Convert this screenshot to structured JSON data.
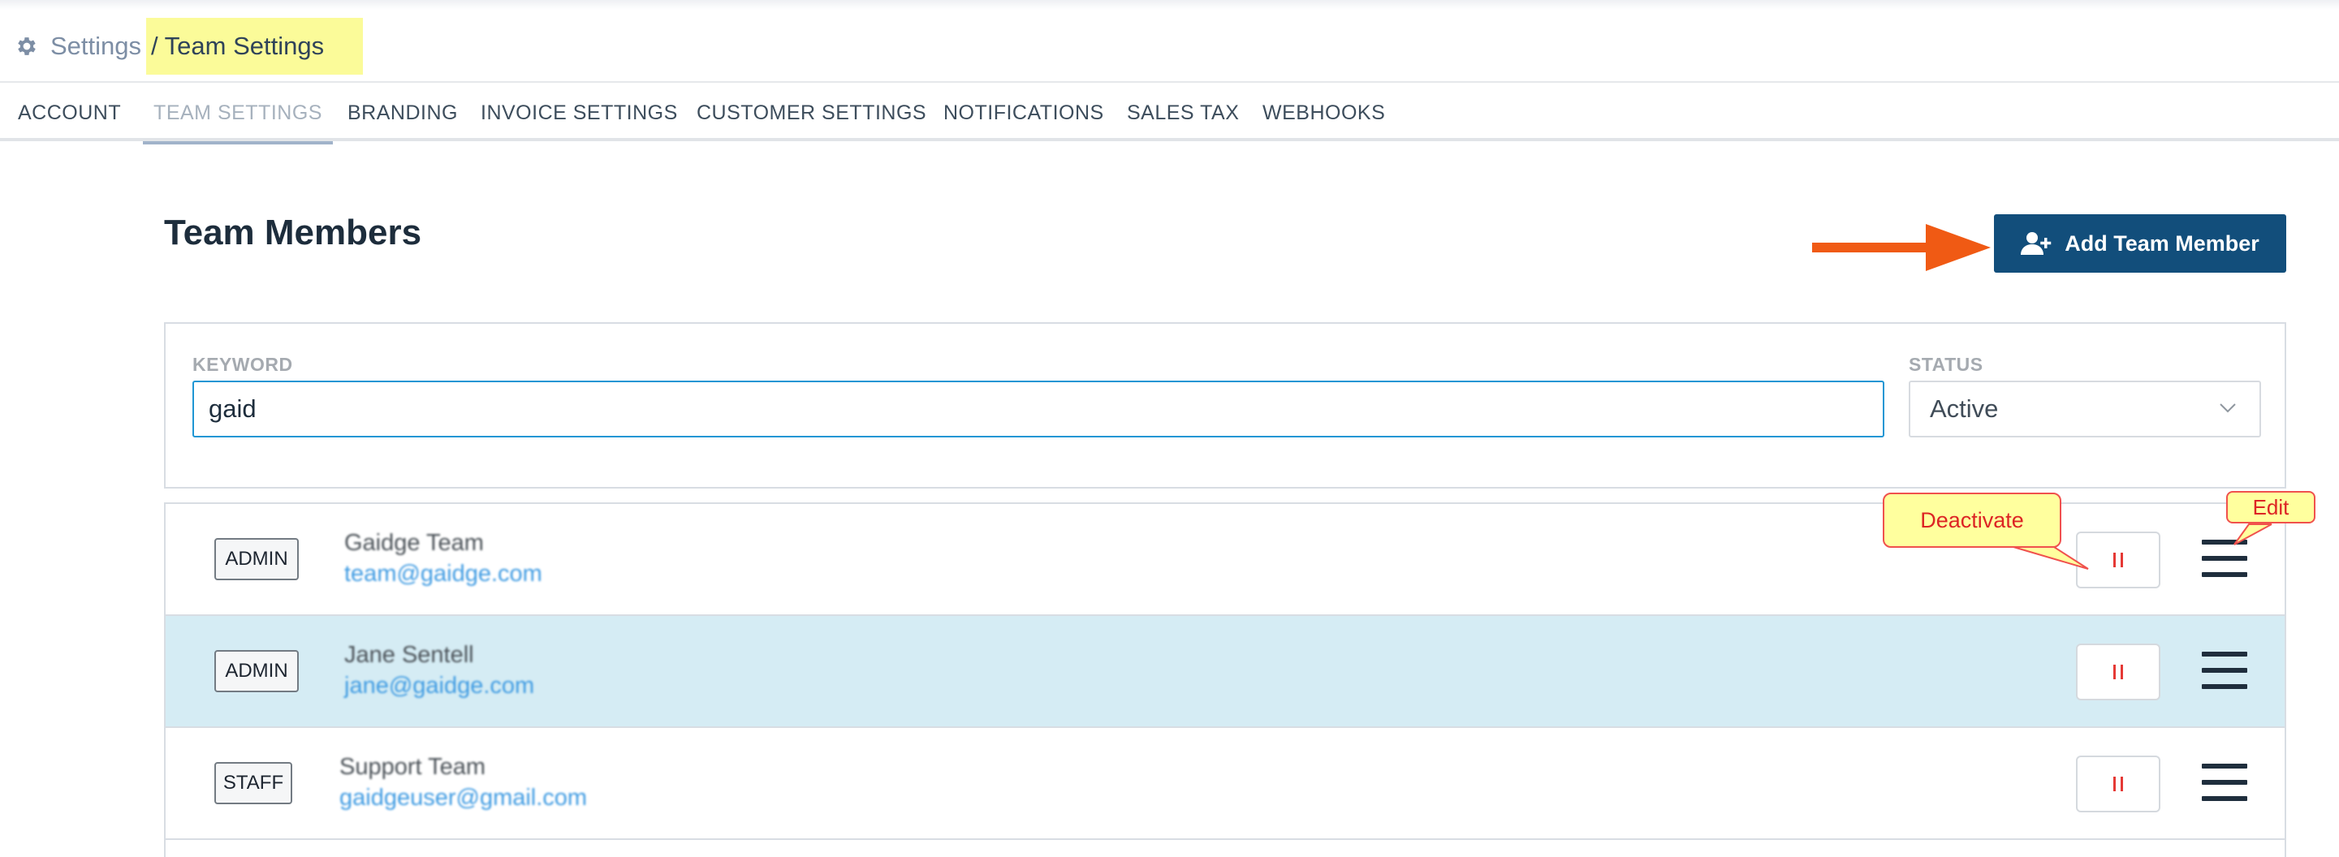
{
  "breadcrumb": {
    "root": "Settings",
    "current": "/ Team Settings"
  },
  "tabs": [
    {
      "label": "ACCOUNT",
      "active": false
    },
    {
      "label": "TEAM SETTINGS",
      "active": true
    },
    {
      "label": "BRANDING",
      "active": false
    },
    {
      "label": "INVOICE SETTINGS",
      "active": false
    },
    {
      "label": "CUSTOMER SETTINGS",
      "active": false
    },
    {
      "label": "NOTIFICATIONS",
      "active": false
    },
    {
      "label": "SALES TAX",
      "active": false
    },
    {
      "label": "WEBHOOKS",
      "active": false
    }
  ],
  "page": {
    "title": "Team Members",
    "add_button_label": "Add Team Member"
  },
  "filters": {
    "keyword_label": "KEYWORD",
    "keyword_value": "gaid",
    "status_label": "STATUS",
    "status_value": "Active"
  },
  "members": [
    {
      "role": "ADMIN",
      "name": "Gaidge Team",
      "email": "team@gaidge.com",
      "highlighted": false
    },
    {
      "role": "ADMIN",
      "name": "Jane Sentell",
      "email": "jane@gaidge.com",
      "highlighted": true
    },
    {
      "role": "STAFF",
      "name": "Support Team",
      "email": "gaidgeuser@gmail.com",
      "highlighted": false
    }
  ],
  "annotations": {
    "deactivate": "Deactivate",
    "edit": "Edit"
  },
  "colors": {
    "primary": "#124e7b",
    "highlight_row": "#d5ecf4",
    "pause_icon": "#e53935",
    "input_focus": "#1e96d4",
    "arrow": "#f05a14",
    "breadcrumb_highlight": "#fbfb99",
    "link": "#3f9be2"
  },
  "icons": {
    "breadcrumb": "gear-icon",
    "add_button": "add-user-icon",
    "row_action_1": "pause-icon",
    "row_action_2": "hamburger-menu-icon",
    "status_select": "chevron-down-icon"
  }
}
